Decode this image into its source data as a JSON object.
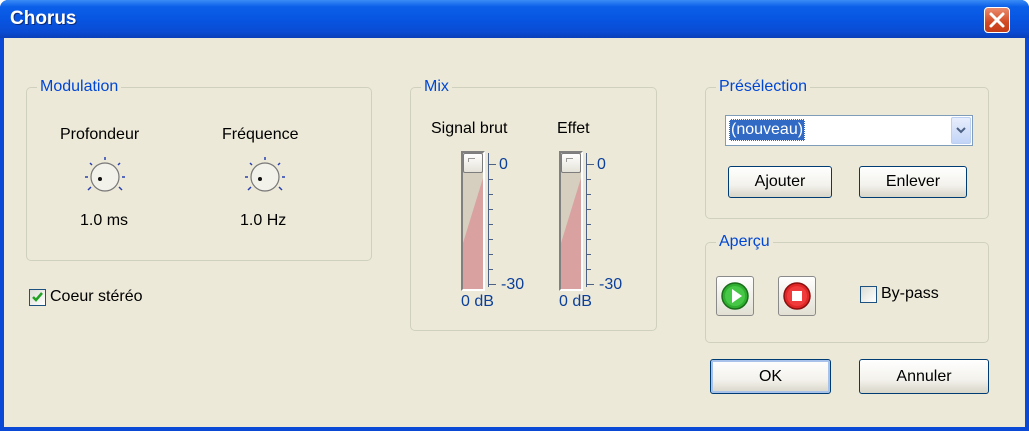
{
  "window": {
    "title": "Chorus"
  },
  "modulation": {
    "group_label": "Modulation",
    "depth_label": "Profondeur",
    "depth_value": "1.0 ms",
    "freq_label": "Fréquence",
    "freq_value": "1.0 Hz",
    "stereo_label": "Coeur stéréo",
    "stereo_checked": true
  },
  "mix": {
    "group_label": "Mix",
    "dry_label": "Signal brut",
    "wet_label": "Effet",
    "scale_top": "0",
    "scale_bottom": "-30",
    "dry_value": "0 dB",
    "wet_value": "0 dB"
  },
  "preset": {
    "group_label": "Présélection",
    "selected": "(nouveau)",
    "add_label": "Ajouter",
    "remove_label": "Enlever"
  },
  "preview": {
    "group_label": "Aperçu",
    "bypass_label": "By-pass",
    "bypass_checked": false
  },
  "footer": {
    "ok_label": "OK",
    "cancel_label": "Annuler"
  },
  "icons": [
    "close-icon",
    "knob-icon",
    "checkmark-icon",
    "dropdown-arrow-icon",
    "play-icon",
    "stop-icon"
  ]
}
